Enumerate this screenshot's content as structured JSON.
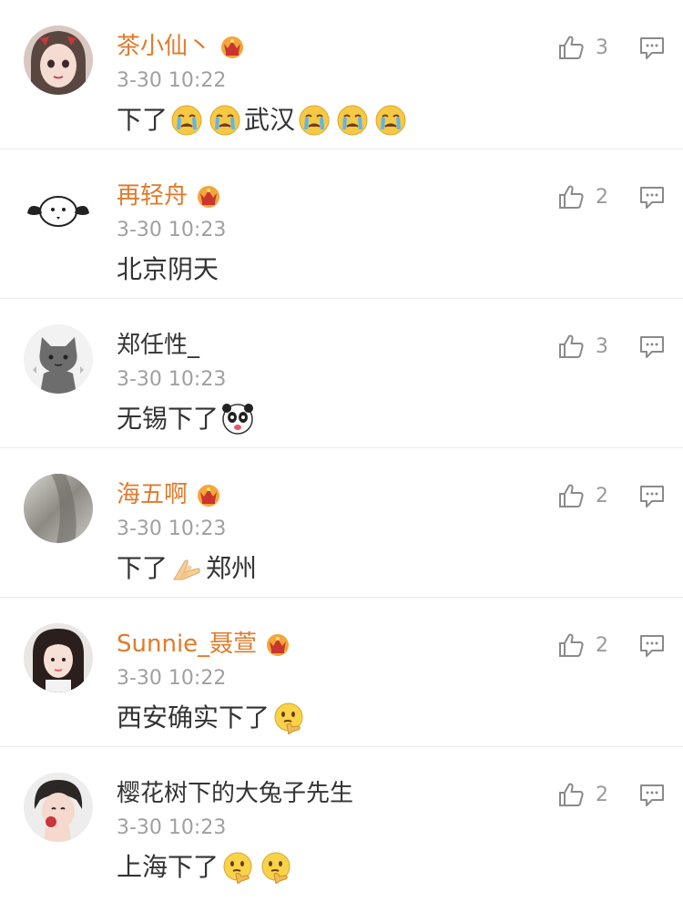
{
  "comments": [
    {
      "username": "茶小仙丶",
      "vip": true,
      "time": "3-30 10:22",
      "text_before": "下了",
      "emojis_before": [
        "crying-emoji",
        "crying-emoji"
      ],
      "text_middle": "武汉",
      "emojis_after": [
        "crying-emoji",
        "crying-emoji",
        "crying-emoji"
      ],
      "likes": "3",
      "avatar": "girl-avatar"
    },
    {
      "username": "再轻舟",
      "vip": true,
      "time": "3-30 10:23",
      "text": "北京阴天",
      "likes": "2",
      "avatar": "sketch-dog-avatar"
    },
    {
      "username": "郑任性_",
      "vip": false,
      "time": "3-30 10:23",
      "text": "无锡下了",
      "emoji": "panda-emoji",
      "likes": "3",
      "avatar": "gray-cat-avatar"
    },
    {
      "username": "海五啊",
      "vip": true,
      "time": "3-30 10:23",
      "text_before": "下了",
      "emoji": "praying-hands-emoji",
      "text_after": "郑州",
      "likes": "2",
      "avatar": "blurry-photo-avatar"
    },
    {
      "username": "Sunnie_聂萱",
      "vip": true,
      "time": "3-30 10:22",
      "text": "西安确实下了",
      "emoji": "thinking-emoji",
      "likes": "2",
      "avatar": "girl-photo-avatar"
    },
    {
      "username": "樱花树下的大兔子先生",
      "vip": false,
      "time": "3-30 10:23",
      "text": "上海下了",
      "emojis": [
        "thinking-emoji",
        "thinking-emoji"
      ],
      "likes": "2",
      "avatar": "boy-photo-avatar"
    }
  ],
  "colors": {
    "vip_name": "#e07a2b",
    "time": "#a0a0a0",
    "count": "#9a9a9a",
    "divider": "#ececec"
  }
}
